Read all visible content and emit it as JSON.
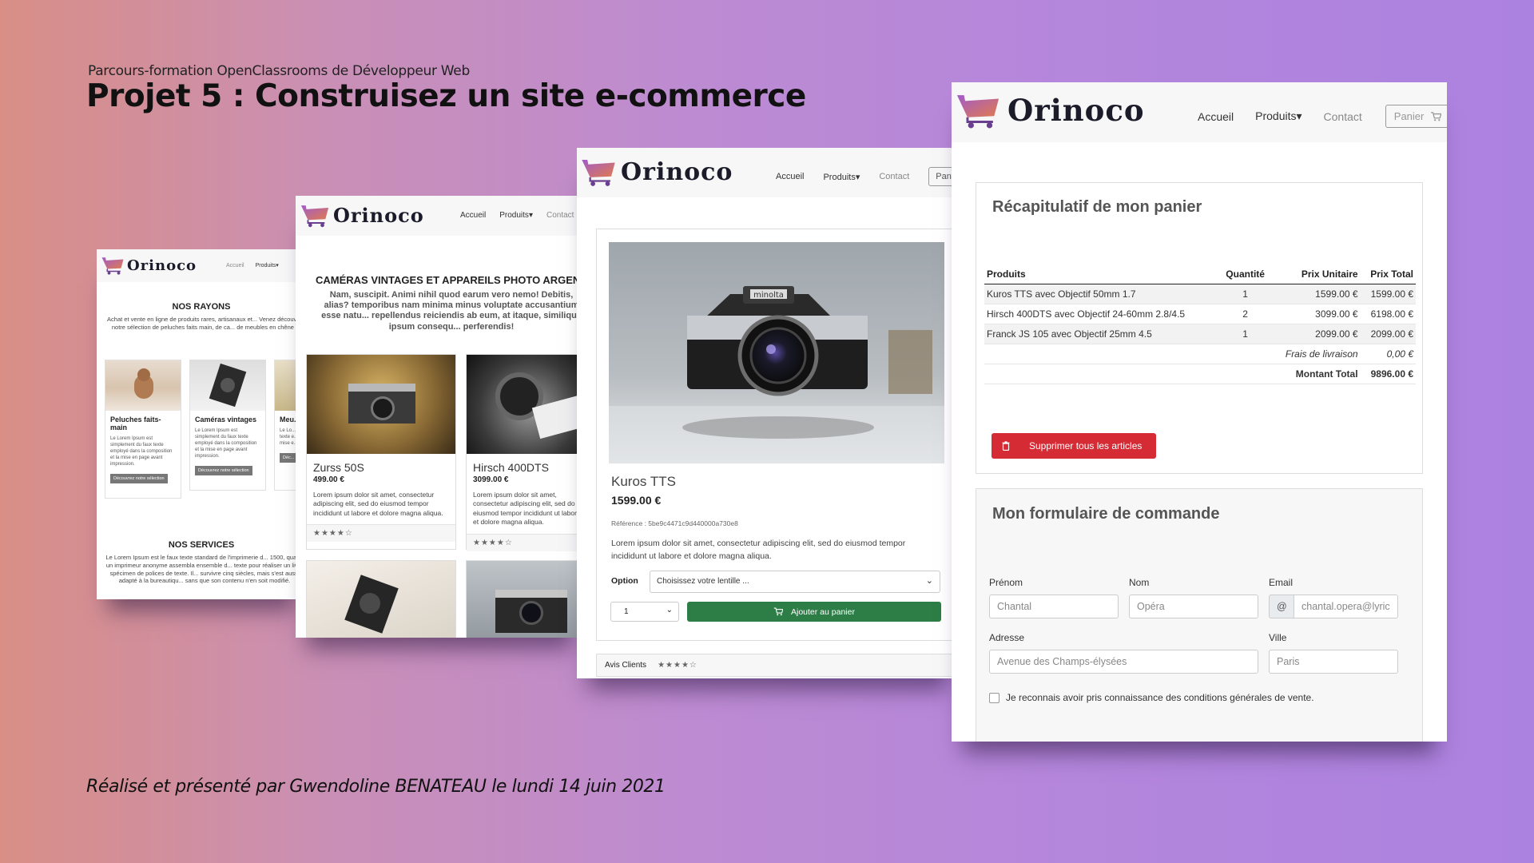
{
  "slide": {
    "subtitle": "Parcours-formation OpenClassrooms de Développeur Web",
    "title": "Projet 5 : Construisez un site e-commerce",
    "credit": "Réalisé et présenté par Gwendoline BENATEAU le lundi 14 juin 2021"
  },
  "brand": {
    "name": "Orinoco",
    "gradient_start": "#a15bc9",
    "gradient_end": "#e07a4f"
  },
  "nav": {
    "home": "Accueil",
    "products": "Produits",
    "contact": "Contact",
    "cart": "Panier",
    "cart_short": "Pa"
  },
  "home_page": {
    "heading_rayons": "NOS RAYONS",
    "intro": "Achat et vente en ligne de produits rares, artisanaux et... Venez découvrir notre sélection de peluches faits main, de ca... de meubles en chêne !",
    "categories": [
      {
        "title": "Peluches faits-main",
        "desc": "Le Lorem Ipsum est simplement du faux texte employé dans la composition et la mise en page avant impression.",
        "button": "Découvrez notre sélection"
      },
      {
        "title": "Caméras vintages",
        "desc": "Le Lorem Ipsum est simplement du faux texte employé dans la composition et la mise en page avant impression.",
        "button": "Découvrez notre sélection"
      },
      {
        "title": "Meu...",
        "desc": "Le Lo... simple... texte e... comp... mise e...",
        "button": "Déc..."
      }
    ],
    "heading_services": "NOS SERVICES",
    "services_text": "Le Lorem Ipsum est le faux texte standard de l'imprimerie d... 1500, quand un imprimeur anonyme assembla ensemble d... texte pour réaliser un livre spécimen de polices de texte. Il... survivre cinq siècles, mais s'est aussi adapté à la bureautiqu... sans que son contenu n'en soit modifié."
  },
  "catalog_page": {
    "heading": "CAMÉRAS VINTAGES ET APPAREILS PHOTO ARGENTI",
    "intro": "Nam, suscipit. Animi nihil quod earum vero nemo! Debitis, alias? temporibus nam minima minus voluptate accusantium esse natu... repellendus reiciendis ab eum, at itaque, similique ipsum consequ... perferendis!",
    "products": [
      {
        "name": "Zurss 50S",
        "price": "499.00 €",
        "desc": "Lorem ipsum dolor sit amet, consectetur adipiscing elit, sed do eiusmod tempor incididunt ut labore et dolore magna aliqua.",
        "rating": 4
      },
      {
        "name": "Hirsch 400DTS",
        "price": "3099.00 €",
        "desc": "Lorem ipsum dolor sit amet, consectetur adipiscing elit, sed do eiusmod tempor incididunt ut labore et dolore magna aliqua.",
        "rating": 4
      }
    ]
  },
  "product_page": {
    "name": "Kuros TTS",
    "price": "1599.00 €",
    "reference": "Référence : 5be9c4471c9d440000a730e8",
    "description": "Lorem ipsum dolor sit amet, consectetur adipiscing elit, sed do eiusmod tempor incididunt ut labore et dolore magna aliqua.",
    "option_label": "Option",
    "option_placeholder": "Choisissez votre lentille ...",
    "quantity": "1",
    "add_button": "Ajouter au panier",
    "reviews_label": "Avis Clients",
    "rating": 4,
    "camera_brand": "minolta"
  },
  "cart_page": {
    "summary_title": "Récapitulatif de mon panier",
    "columns": [
      "Produits",
      "Quantité",
      "Prix Unitaire",
      "Prix Total"
    ],
    "rows": [
      [
        "Kuros TTS avec Objectif 50mm 1.7",
        "1",
        "1599.00 €",
        "1599.00 €"
      ],
      [
        "Hirsch 400DTS avec Objectif 24-60mm 2.8/4.5",
        "2",
        "3099.00 €",
        "6198.00 €"
      ],
      [
        "Franck JS 105 avec Objectif 25mm 4.5",
        "1",
        "2099.00 €",
        "2099.00 €"
      ]
    ],
    "shipping_label": "Frais de livraison",
    "shipping_value": "0,00 €",
    "total_label": "Montant Total",
    "total_value": "9896.00 €",
    "delete_button": "Supprimer tous les articles",
    "form_title": "Mon formulaire de commande",
    "fields": {
      "firstname": {
        "label": "Prénom",
        "placeholder": "Chantal"
      },
      "lastname": {
        "label": "Nom",
        "placeholder": "Opéra"
      },
      "email": {
        "label": "Email",
        "prefix": "@",
        "placeholder": "chantal.opera@lyric"
      },
      "address": {
        "label": "Adresse",
        "placeholder": "Avenue des Champs-élysées"
      },
      "city": {
        "label": "Ville",
        "placeholder": "Paris"
      }
    },
    "terms": "Je reconnais avoir pris connaissance des conditions générales de vente."
  }
}
